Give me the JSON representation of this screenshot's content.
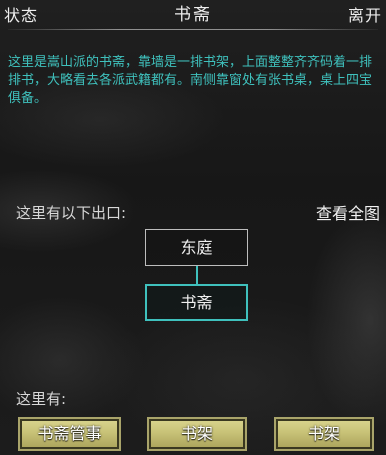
{
  "header": {
    "status_label": "状态",
    "title": "书斋",
    "leave_label": "离开"
  },
  "room": {
    "description": "这里是嵩山派的书斋，靠墙是一排书架，上面整整齐齐码着一排排书，大略看去各派武籍都有。南侧靠窗处有张书桌，桌上四宝俱备。"
  },
  "exits": {
    "label": "这里有以下出口:",
    "view_map_label": "查看全图",
    "east": "东庭",
    "current": "书斋"
  },
  "here": {
    "label": "这里有:",
    "items": [
      "书斋管事",
      "书架",
      "书架"
    ]
  },
  "colors": {
    "description_text": "#3fc1bd",
    "current_room_border": "#3fc1bd",
    "npc_button": "#c8c277"
  }
}
